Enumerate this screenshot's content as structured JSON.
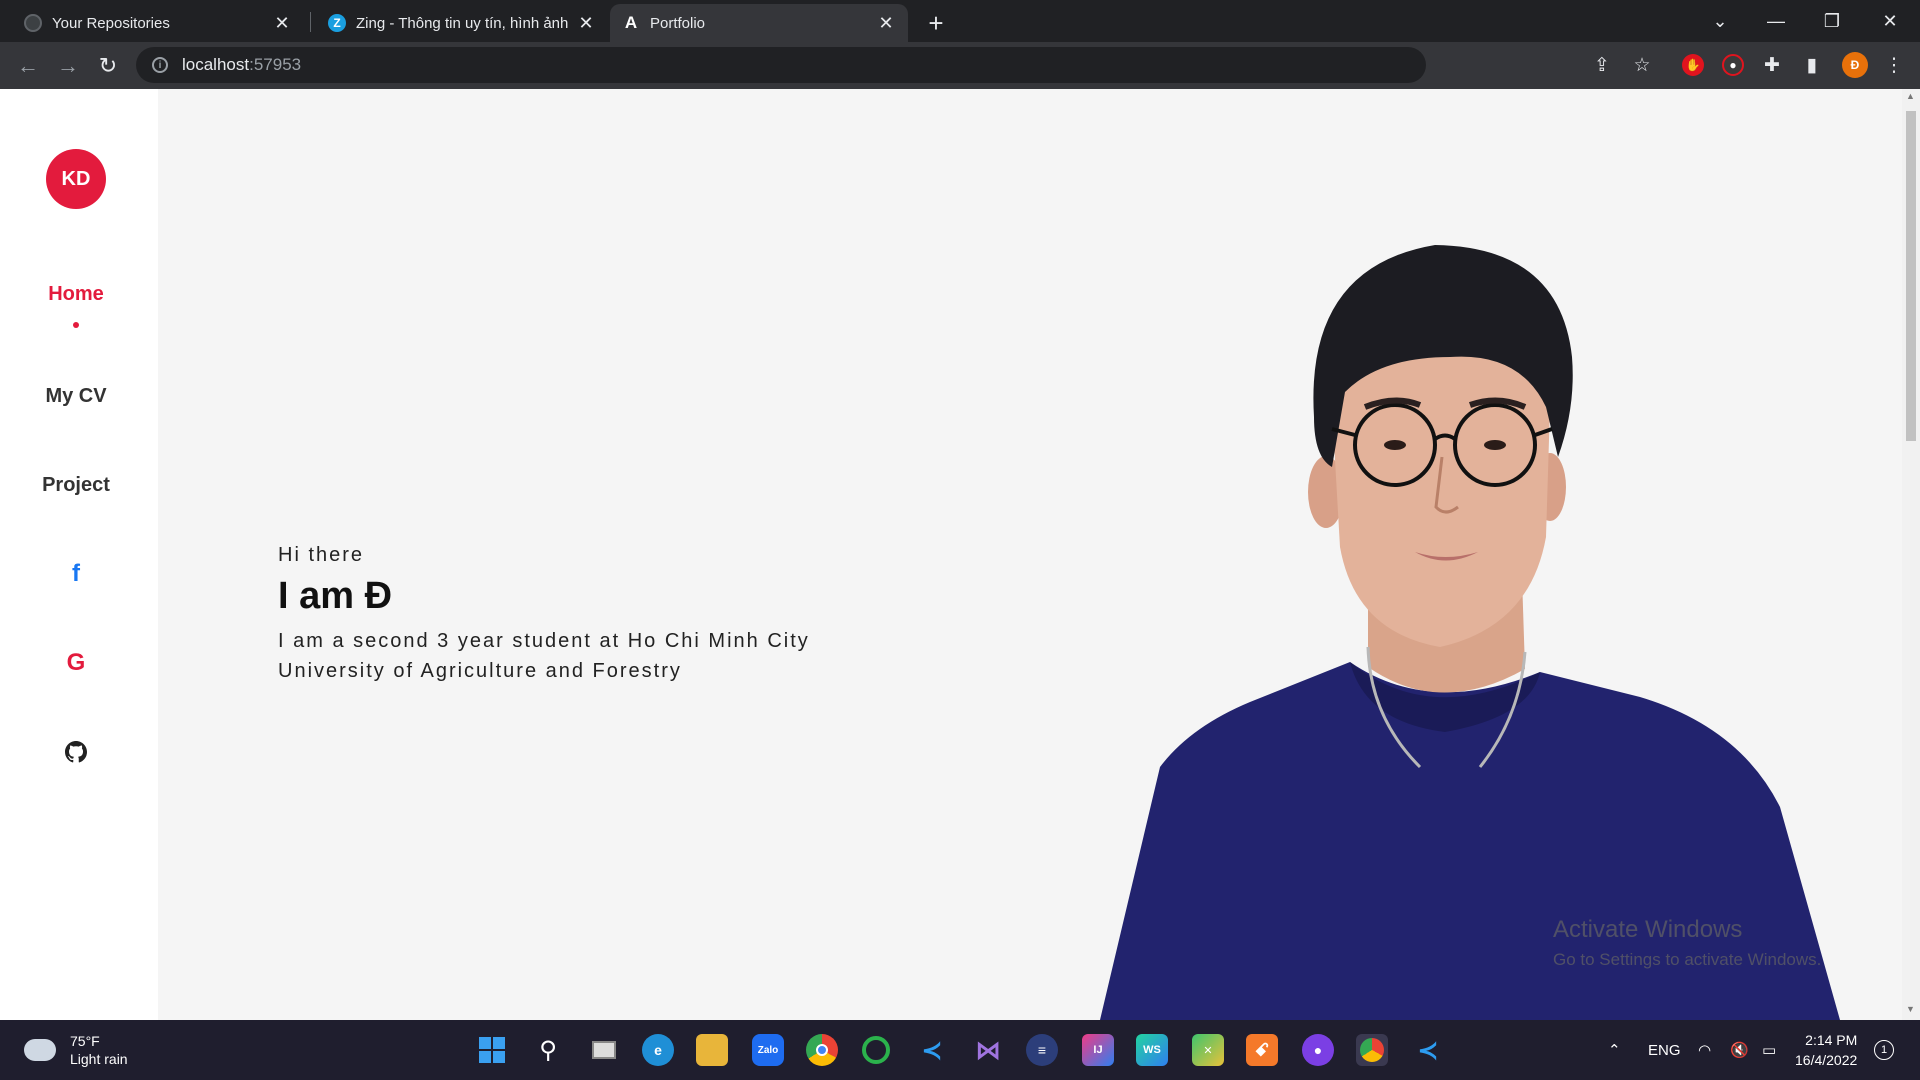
{
  "browser": {
    "tabs": [
      {
        "title": "Your Repositories",
        "favicon": "github-icon"
      },
      {
        "title": "Zing - Thông tin uy tín, hình ảnh",
        "favicon": "zing-icon"
      },
      {
        "title": "Portfolio",
        "favicon": "angular-icon"
      }
    ],
    "active_tab": 2,
    "url_host": "localhost",
    "url_port": ":57953",
    "profile_initial": "Đ"
  },
  "sidebar": {
    "logo": "KD",
    "nav": [
      {
        "label": "Home"
      },
      {
        "label": "My CV"
      },
      {
        "label": "Project"
      }
    ],
    "social": [
      {
        "icon": "facebook-icon",
        "glyph": "f",
        "color": "#1877f2"
      },
      {
        "icon": "google-icon",
        "glyph": "G",
        "color": "#e31b3d"
      },
      {
        "icon": "github-icon",
        "glyph": "",
        "color": "#222222"
      }
    ]
  },
  "hero": {
    "greeting": "Hi there",
    "name": "I am Đ",
    "description": "I am a second 3 year student at Ho Chi Minh City University of Agriculture and Forestry"
  },
  "watermark": {
    "title": "Activate Windows",
    "subtitle": "Go to Settings to activate Windows."
  },
  "taskbar": {
    "weather_temp": "75°F",
    "weather_desc": "Light rain",
    "lang": "ENG",
    "time": "2:14 PM",
    "date": "16/4/2022",
    "notification_count": "1"
  },
  "colors": {
    "accent": "#e31b3d",
    "tab_bg": "#202124",
    "toolbar_bg": "#35363a"
  }
}
